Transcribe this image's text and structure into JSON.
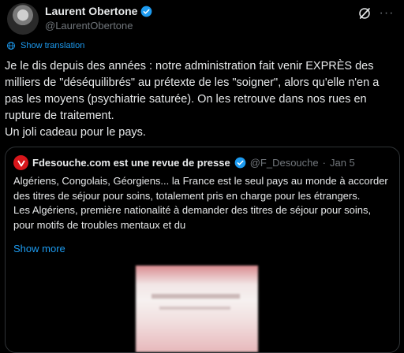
{
  "author": {
    "name": "Laurent Obertone",
    "handle": "@LaurentObertone"
  },
  "icons": {
    "verified": "verified-badge-icon",
    "grok": "grok-icon",
    "more": "more-options-icon",
    "globe": "globe-icon"
  },
  "colors": {
    "background": "#000000",
    "text": "#e7e9ea",
    "muted": "#71767b",
    "accent": "#1d9bf0",
    "border": "#2f3336",
    "quote_avatar": "#d8161b"
  },
  "translate_label": "Show translation",
  "tweet": {
    "paragraph1": "Je le dis depuis des années : notre administration fait venir EXPRÈS des milliers de \"déséquilibrés\" au prétexte de les \"soigner\", alors qu'elle n'en a pas les moyens (psychiatrie saturée). On les retrouve dans nos rues en rupture de traitement.",
    "paragraph2": "Un joli cadeau pour le pays."
  },
  "quote": {
    "name": "Fdesouche.com est une revue de presse",
    "handle": "@F_Desouche",
    "separator": "·",
    "date": "Jan 5",
    "paragraph1": "Algériens, Congolais, Géorgiens... la France est le seul pays au monde à accorder des titres de séjour pour soins, totalement pris en charge pour les étrangers.",
    "paragraph2": "Les Algériens, première nationalité à demander des titres de séjour pour soins, pour motifs de troubles mentaux et du",
    "show_more": "Show more"
  }
}
